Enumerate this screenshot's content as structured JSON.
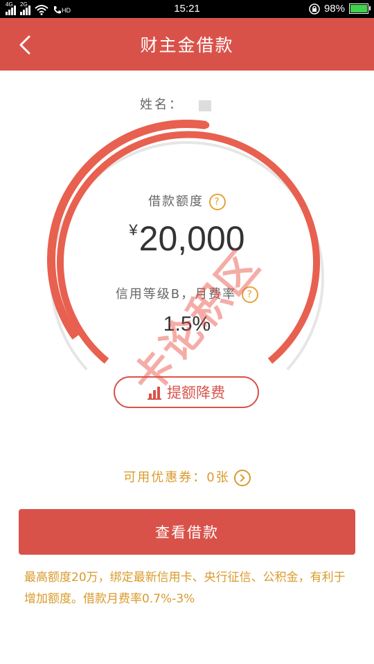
{
  "status_bar": {
    "network_1": "4G",
    "network_2": "2G",
    "hd": "HD",
    "time": "15:21",
    "battery": "98%",
    "battery_level": 0.98
  },
  "header": {
    "title": "财主金借款"
  },
  "profile": {
    "name_label": "姓名："
  },
  "dial": {
    "limit_label": "借款额度",
    "currency": "¥",
    "amount": "20,000",
    "grade_label": "信用等级B，月费率",
    "monthly_rate": "1.5%"
  },
  "raise_button": {
    "label": "提额降费"
  },
  "coupon": {
    "text": "可用优惠券：0张"
  },
  "main_button": {
    "label": "查看借款"
  },
  "note": {
    "text": "最高额度20万，绑定最新信用卡、央行征信、公积金，有利于增加额度。借款月费率0.7%-3%"
  },
  "watermark": {
    "text": "卡论积区"
  },
  "colors": {
    "primary": "#d9524a",
    "accent": "#d99a2b",
    "gauge_track": "#e6e6e6",
    "gauge_fill": "#e8604f"
  }
}
